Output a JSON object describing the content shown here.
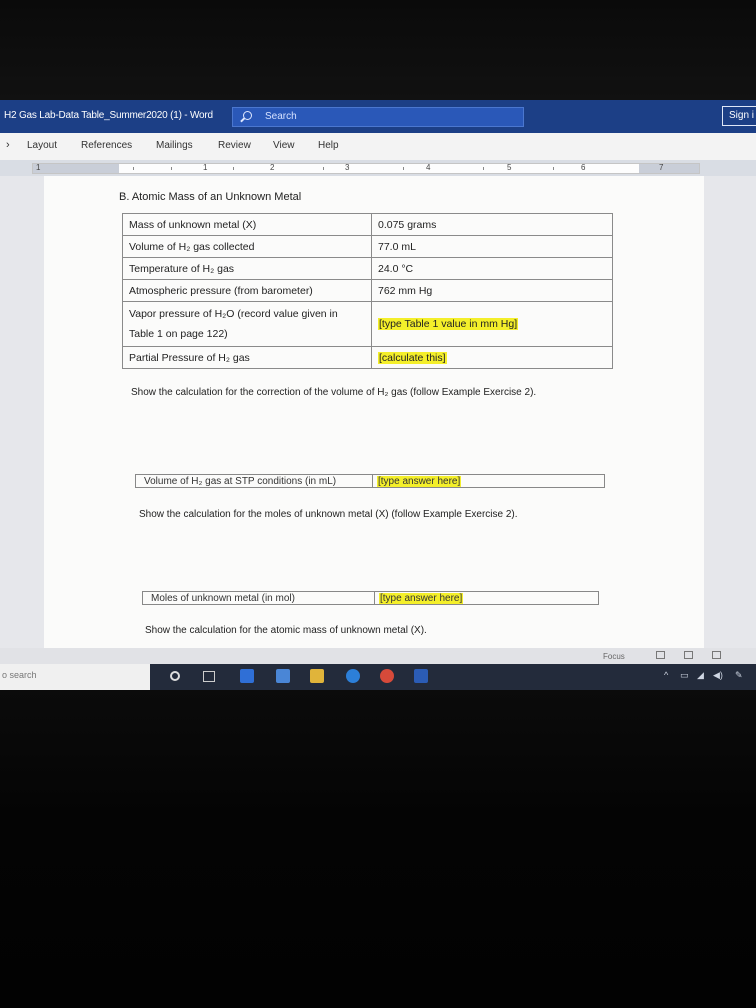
{
  "window": {
    "title": "H2 Gas Lab-Data Table_Summer2020 (1)  -  Word",
    "search_placeholder": "Search",
    "sign_in": "Sign i"
  },
  "ribbon": {
    "tabs": [
      "Layout",
      "References",
      "Mailings",
      "Review",
      "View",
      "Help"
    ]
  },
  "ruler": {
    "numbers": [
      "1",
      "2",
      "3",
      "4",
      "5",
      "6",
      "7"
    ]
  },
  "document": {
    "section_heading": "B. Atomic Mass of an Unknown Metal",
    "table": [
      {
        "label": "Mass of unknown metal (X)",
        "value": "0.075 grams",
        "highlight": false
      },
      {
        "label": "Volume of H₂ gas collected",
        "value": "77.0 mL",
        "highlight": false
      },
      {
        "label": "Temperature of H₂ gas",
        "value": "24.0 °C",
        "highlight": false
      },
      {
        "label": "Atmospheric pressure (from barometer)",
        "value": "762 mm Hg",
        "highlight": false
      },
      {
        "label": "Vapor pressure of H₂O (record value given in Table 1 on page 122)",
        "value": "[type Table 1 value in mm Hg]",
        "highlight": true
      },
      {
        "label": "Partial Pressure of H₂ gas",
        "value": "[calculate this]",
        "highlight": true
      }
    ],
    "instruction_1": "Show the calculation for the correction of the volume of H₂ gas (follow Example Exercise 2).",
    "answer_1": {
      "label": "Volume of H₂ gas at STP conditions (in mL)",
      "value": "[type answer here]"
    },
    "instruction_2": "Show the calculation for the moles of unknown metal (X) (follow Example Exercise 2).",
    "answer_2": {
      "label": "Moles of unknown metal (in mol)",
      "value": "[type answer here]"
    },
    "instruction_3": "Show the calculation for the atomic mass of unknown metal (X)."
  },
  "status_bar": {
    "focus_label": "Focus"
  },
  "taskbar": {
    "search_text": "o search"
  },
  "colors": {
    "title_bar": "#1c3f86",
    "highlight": "#f4ef2a",
    "taskbar": "#232b3b"
  }
}
